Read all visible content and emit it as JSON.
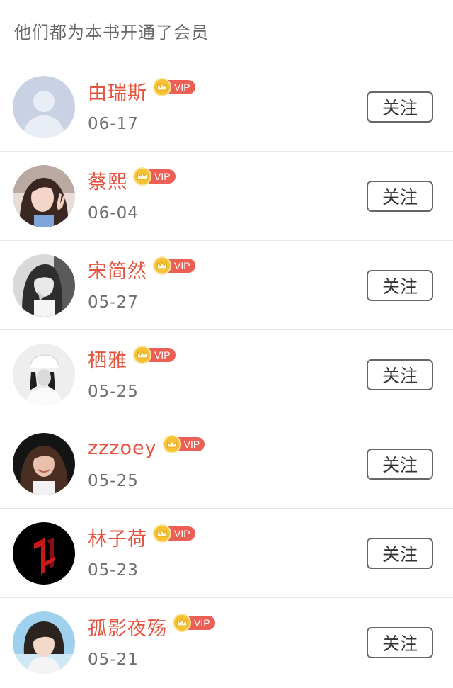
{
  "header": {
    "title": "他们都为本书开通了会员"
  },
  "colors": {
    "name": "#e5533f",
    "vip_tag": "#ec5f55",
    "crown": "#f7c232",
    "date": "#6f6f6f"
  },
  "users": [
    {
      "name": "由瑞斯",
      "badge": "VIP",
      "date": "06-17",
      "follow_label": "关注",
      "avatar": "default-silhouette"
    },
    {
      "name": "蔡熙",
      "badge": "VIP",
      "date": "06-04",
      "follow_label": "关注",
      "avatar": "girl-peace-sign"
    },
    {
      "name": "宋简然",
      "badge": "VIP",
      "date": "05-27",
      "follow_label": "关注",
      "avatar": "girl-monochrome"
    },
    {
      "name": "栖雅",
      "badge": "VIP",
      "date": "05-25",
      "follow_label": "关注",
      "avatar": "girl-cap-monochrome"
    },
    {
      "name": "zzzoey",
      "badge": "VIP",
      "date": "05-25",
      "follow_label": "关注",
      "avatar": "girl-dark-background"
    },
    {
      "name": "林子荷",
      "badge": "VIP",
      "date": "05-23",
      "follow_label": "关注",
      "avatar": "red-logo-black"
    },
    {
      "name": "孤影夜殇",
      "badge": "VIP",
      "date": "05-21",
      "follow_label": "关注",
      "avatar": "boy-sky-background"
    }
  ]
}
